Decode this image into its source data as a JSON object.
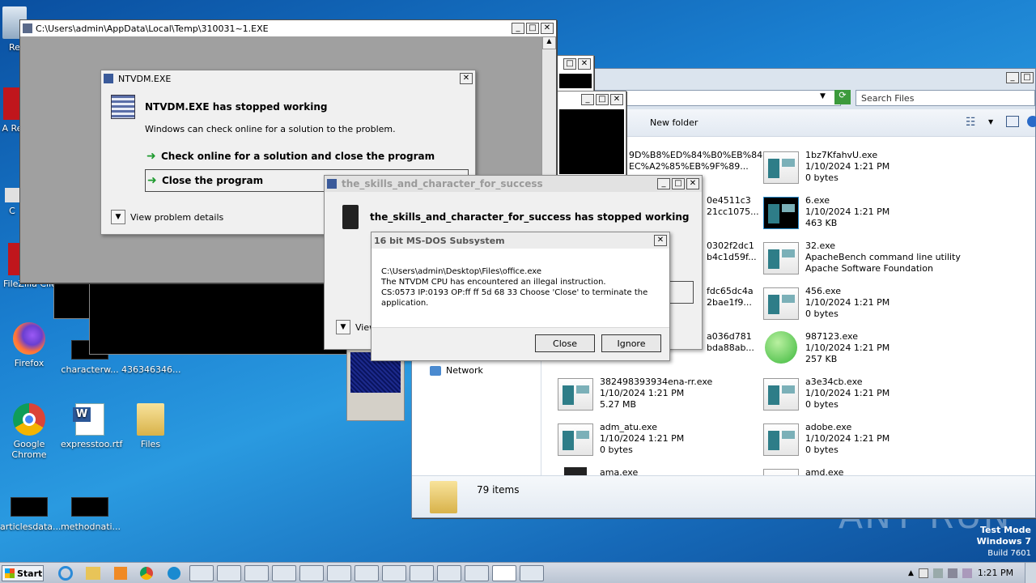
{
  "desktop": {
    "icons": [
      {
        "label": "Re"
      },
      {
        "label": "A Re"
      },
      {
        "label": "C"
      },
      {
        "label": "FileZilla Client"
      },
      {
        "label": "Firefox"
      },
      {
        "label": "characterw..."
      },
      {
        "label": "436346346..."
      },
      {
        "label": "Google Chrome"
      },
      {
        "label": "expresstoo.rtf"
      },
      {
        "label": "Files"
      },
      {
        "label": "articlesdata..."
      },
      {
        "label": "methodnati..."
      }
    ]
  },
  "console_window": {
    "title": "C:\\Users\\admin\\AppData\\Local\\Temp\\310031~1.EXE"
  },
  "ntvdm_dialog": {
    "title": "NTVDM.EXE",
    "heading": "NTVDM.EXE has stopped working",
    "message": "Windows can check online for a solution to the problem.",
    "option1": "Check online for a solution and close the program",
    "option2": "Close the program",
    "details": "View problem details"
  },
  "skills_dialog": {
    "title": "the_skills_and_character_for_success",
    "heading": "the_skills_and_character_for_success has stopped working",
    "details": "View"
  },
  "msdos_dialog": {
    "title": "16 bit MS-DOS Subsystem",
    "line1": "C:\\Users\\admin\\Desktop\\Files\\office.exe",
    "line2": "The NTVDM CPU has encountered an illegal instruction.",
    "line3": "CS:0573 IP:0193 OP:ff ff 5d 68 33 Choose 'Close' to terminate the",
    "line4": "application.",
    "close_label": "Close",
    "ignore_label": "Ignore"
  },
  "explorer": {
    "search_placeholder": "Search Files",
    "new_folder": "New folder",
    "network": "Network",
    "item_count": "79 items",
    "partial_names": [
      "9D%B8%ED%84%B0%EB%84",
      "EC%A2%85%EB%9F%89...",
      "0e4511c3",
      "21cc1075...",
      "0302f2dc1",
      "b4c1d59f...",
      "fdc65dc4a",
      "2bae1f9...",
      "a036d781",
      "bda88ab..."
    ],
    "files": [
      {
        "name": "1bz7KfahvU.exe",
        "line2": "1/10/2024 1:21 PM",
        "line3": "0 bytes"
      },
      {
        "name": "6.exe",
        "line2": "1/10/2024 1:21 PM",
        "line3": "463 KB"
      },
      {
        "name": "32.exe",
        "line2": "ApacheBench command line utility",
        "line3": "Apache Software Foundation"
      },
      {
        "name": "456.exe",
        "line2": "1/10/2024 1:21 PM",
        "line3": "0 bytes"
      },
      {
        "name": "987123.exe",
        "line2": "1/10/2024 1:21 PM",
        "line3": "257 KB"
      },
      {
        "name": "382498393934ena-rr.exe",
        "line2": "1/10/2024 1:21 PM",
        "line3": "5.27 MB"
      },
      {
        "name": "a3e34cb.exe",
        "line2": "1/10/2024 1:21 PM",
        "line3": "0 bytes"
      },
      {
        "name": "adm_atu.exe",
        "line2": "1/10/2024 1:21 PM",
        "line3": "0 bytes"
      },
      {
        "name": "adobe.exe",
        "line2": "1/10/2024 1:21 PM",
        "line3": "0 bytes"
      },
      {
        "name": "ama.exe",
        "line2": "",
        "line3": ""
      },
      {
        "name": "amd.exe",
        "line2": "",
        "line3": ""
      }
    ]
  },
  "watermark": {
    "brand": "ANY RUN",
    "test_mode": "Test Mode",
    "os": "Windows 7",
    "build": "Build 7601"
  },
  "taskbar": {
    "start_label": "Start",
    "clock": "1:21 PM"
  },
  "colors": {
    "desktop_blue": "#1a7fd0",
    "dialog_bg": "#f0f0f0",
    "success_green": "#1e9a2e"
  }
}
